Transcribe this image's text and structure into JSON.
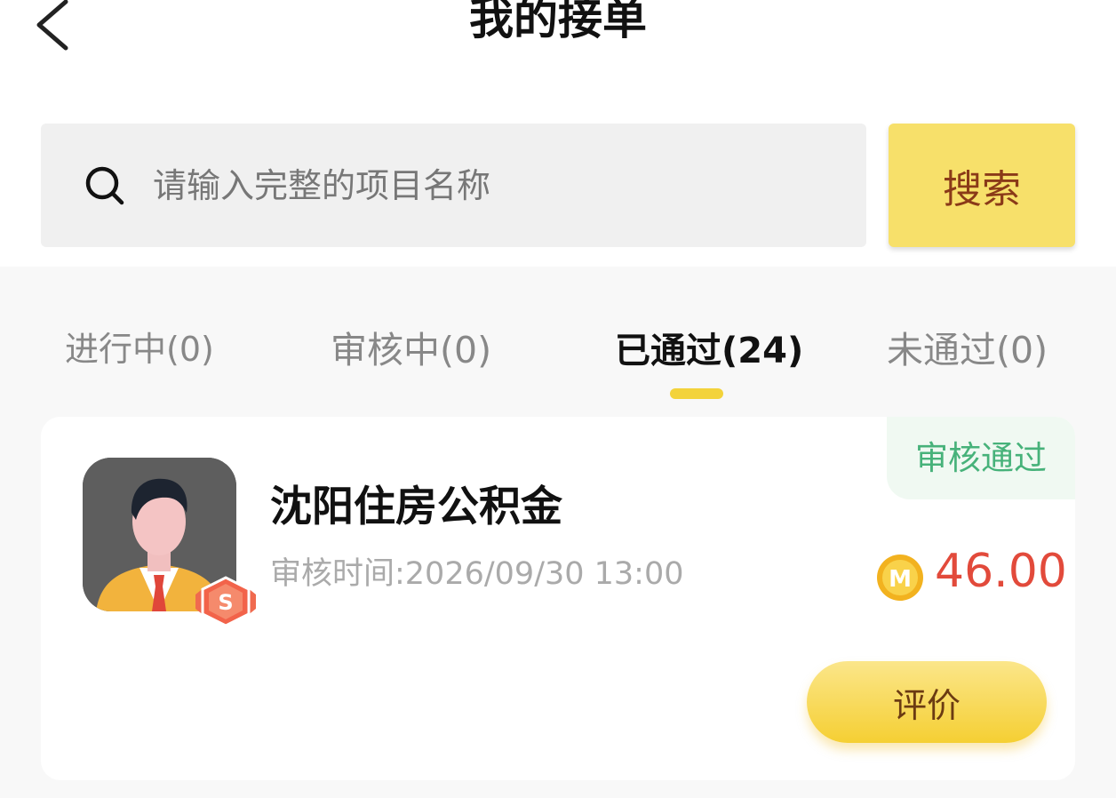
{
  "header": {
    "title": "我的接单",
    "back_icon": "chevron-left-icon"
  },
  "search": {
    "placeholder": "请输入完整的项目名称",
    "value": "",
    "button_label": "搜索",
    "icon": "search-icon"
  },
  "tabs": [
    {
      "label": "进行中(0)",
      "active": false
    },
    {
      "label": "审核中(0)",
      "active": false
    },
    {
      "label": "已通过(24)",
      "active": true
    },
    {
      "label": "未通过(0)",
      "active": false
    }
  ],
  "orders": [
    {
      "status": "审核通过",
      "project_name": "沈阳住房公积金",
      "review_time": "审核时间:2026/09/30 13:00",
      "amount": "46.00",
      "coin_icon": "m-coin-icon",
      "level_badge": "S",
      "action_label": "评价"
    }
  ],
  "colors": {
    "accent_yellow": "#f7e06a",
    "status_green": "#47b27a",
    "amount_red": "#e24a3b",
    "tab_indicator": "#f3d33b"
  }
}
